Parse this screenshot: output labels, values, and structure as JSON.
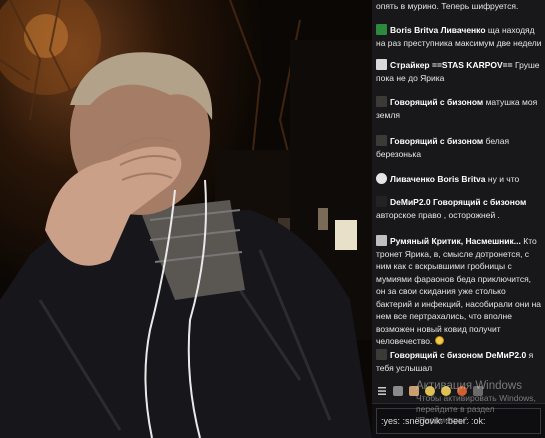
{
  "chat": {
    "top_text": "опять в мурино. Теперь шифруется.",
    "messages": [
      {
        "user": "Boris Britva",
        "user2": "Ливаченко",
        "text": "ща находяд на раз преступника максимум две недели"
      },
      {
        "user": "Страйкер ==STAS KARPOV==",
        "text": "Груше пока не до Ярика"
      },
      {
        "user": "Говорящий с бизоном",
        "text": "матушка моя земля"
      },
      {
        "user": "Говорящий с бизоном",
        "text": "белая березонька"
      },
      {
        "user": "Ливаченко",
        "user2": "Boris Britva",
        "text": "ну и что"
      },
      {
        "user": "DeMиP2.0",
        "user2": "Говорящий с бизоном",
        "text": "авторское право , осторожней ."
      },
      {
        "user": "Румяный Критик, Насмешник...",
        "text": "Кто тронет Ярика, в, смысле дотронется, с ним как с вскрывшими гробницы с мумиями фараонов беда приключится, он за свои скидания уже столько бактерий и инфекций, насобирали они на нем все пертрахались, что вполне возможен новый ковид получит человечество."
      },
      {
        "user": "Говорящий с бизоном",
        "user2": "DeMиP2.0",
        "text": "я тебя услышал"
      }
    ],
    "input_value": ":yes: :snegovik: :beer: :ok:"
  },
  "os_watermark": {
    "line1": "Активация Windows",
    "line2": "Чтобы активировать Windows, перейдите в раздел \"Параметры\"."
  },
  "colors": {
    "chat_bg": "#18181b",
    "name": "#ffffff",
    "text": "#e6e6e6"
  }
}
